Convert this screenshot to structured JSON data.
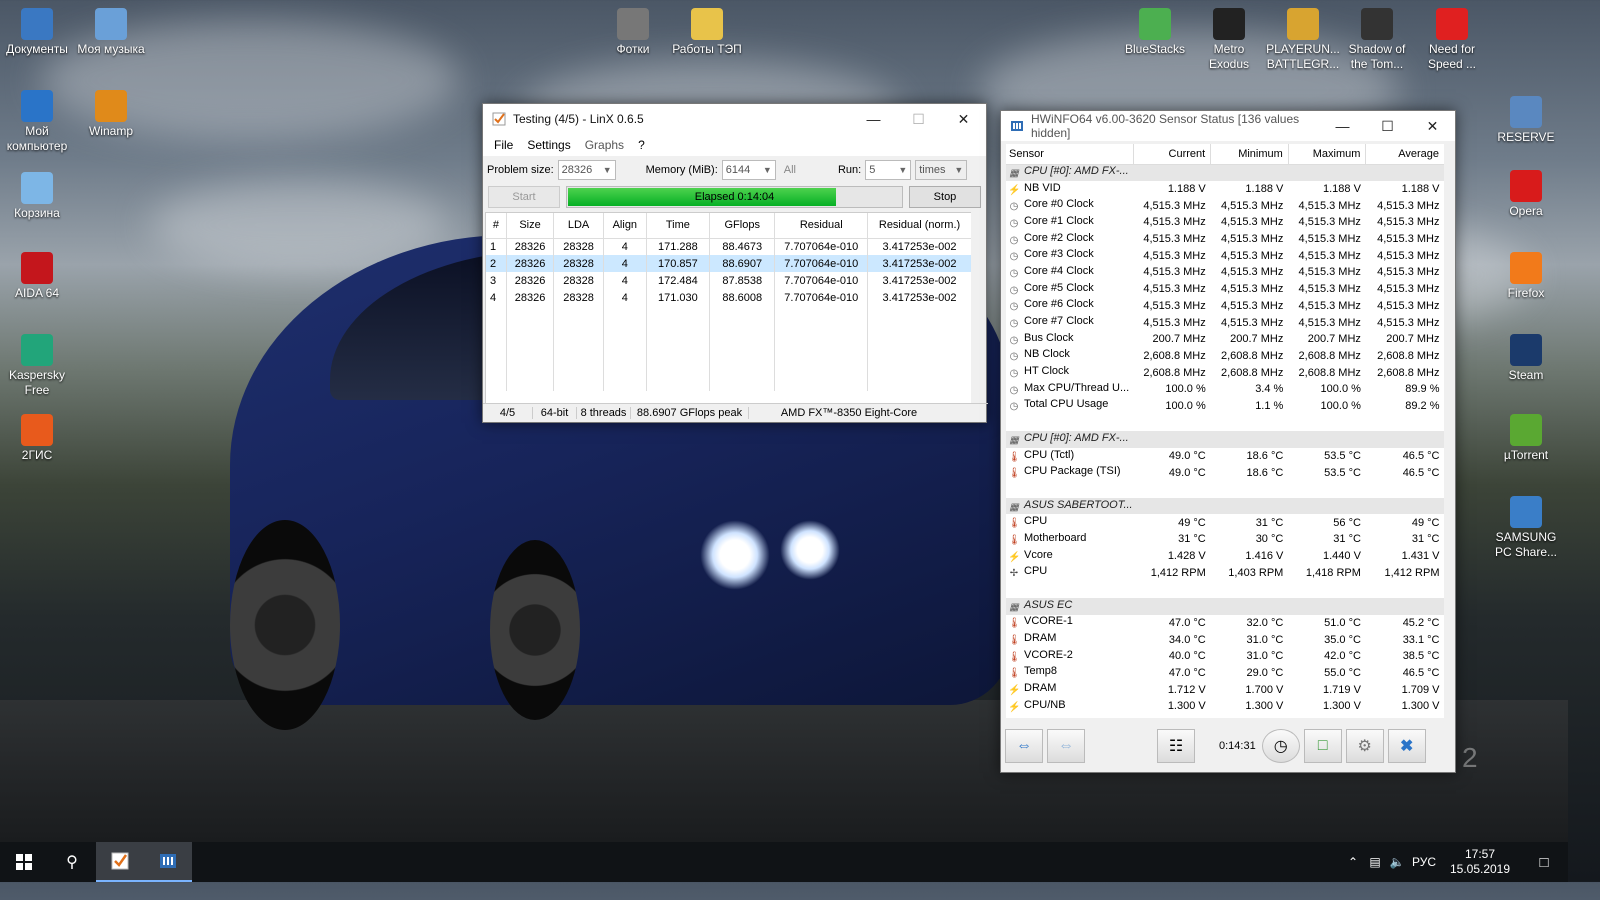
{
  "desktop": {
    "left_icons": [
      {
        "label": "Документы",
        "icon": "documents-icon",
        "color": "#3a78c2"
      },
      {
        "label": "Моя музыка",
        "icon": "music-icon",
        "color": "#6aa0d8"
      },
      {
        "label": "Мой компьютер",
        "icon": "computer-icon",
        "color": "#2a74c8"
      },
      {
        "label": "Winamp",
        "icon": "winamp-icon",
        "color": "#e08a1a"
      },
      {
        "label": "Корзина",
        "icon": "recycle-bin-icon",
        "color": "#7db6e6"
      },
      {
        "label": "AIDA 64",
        "icon": "aida64-icon",
        "color": "#c4161c"
      },
      {
        "label": "Kaspersky Free",
        "icon": "kaspersky-icon",
        "color": "#22a57a"
      },
      {
        "label": "2ГИС",
        "icon": "2gis-icon",
        "color": "#e85a1c"
      }
    ],
    "top_icons": [
      {
        "label": "Фотки",
        "icon": "camera-icon",
        "color": "#777777"
      },
      {
        "label": "Работы ТЭП",
        "icon": "folder-icon",
        "color": "#e8c34a"
      },
      {
        "label": "BlueStacks",
        "icon": "bluestacks-icon",
        "color": "#4caf50"
      },
      {
        "label": "Metro Exodus",
        "icon": "metro-exodus-icon",
        "color": "#222222"
      },
      {
        "label": "PLAYERUN... BATTLEGR...",
        "icon": "pubg-icon",
        "color": "#d8a430"
      },
      {
        "label": "Shadow of the Tom...",
        "icon": "tomb-raider-icon",
        "color": "#333333"
      },
      {
        "label": "Need for Speed ...",
        "icon": "nfs-icon",
        "color": "#e02020"
      }
    ],
    "right_icons": [
      {
        "label": "RESERVE",
        "icon": "reserve-icon",
        "color": "#5a88c0"
      },
      {
        "label": "Opera",
        "icon": "opera-icon",
        "color": "#d81b1b"
      },
      {
        "label": "Firefox",
        "icon": "firefox-icon",
        "color": "#f27a1a"
      },
      {
        "label": "Steam",
        "icon": "steam-icon",
        "color": "#1b3a6b"
      },
      {
        "label": "µTorrent",
        "icon": "utorrent-icon",
        "color": "#5aa832"
      },
      {
        "label": "SAMSUNG PC Share...",
        "icon": "samsung-icon",
        "color": "#3a7ec8"
      }
    ],
    "watermark": "2"
  },
  "linx": {
    "title": "Testing (4/5) - LinX 0.6.5",
    "menu": [
      "File",
      "Settings",
      "Graphs",
      "?"
    ],
    "problem_size_label": "Problem size:",
    "problem_size": "28326",
    "memory_label": "Memory (MiB):",
    "memory": "6144",
    "all_label": "All",
    "run_label": "Run:",
    "run": "5",
    "run_unit": "times",
    "start_label": "Start",
    "elapsed": "Elapsed 0:14:04",
    "progress": 0.8,
    "stop_label": "Stop",
    "columns": [
      "#",
      "Size",
      "LDA",
      "Align",
      "Time",
      "GFlops",
      "Residual",
      "Residual (norm.)"
    ],
    "rows": [
      [
        "1",
        "28326",
        "28328",
        "4",
        "171.288",
        "88.4673",
        "7.707064e-010",
        "3.417253e-002"
      ],
      [
        "2",
        "28326",
        "28328",
        "4",
        "170.857",
        "88.6907",
        "7.707064e-010",
        "3.417253e-002"
      ],
      [
        "3",
        "28326",
        "28328",
        "4",
        "172.484",
        "87.8538",
        "7.707064e-010",
        "3.417253e-002"
      ],
      [
        "4",
        "28326",
        "28328",
        "4",
        "171.030",
        "88.6008",
        "7.707064e-010",
        "3.417253e-002"
      ]
    ],
    "selected_row": 1,
    "status": [
      "4/5",
      "64-bit",
      "8 threads",
      "88.6907 GFlops peak",
      "AMD FX™-8350 Eight-Core"
    ]
  },
  "hwinfo": {
    "title": "HWiNFO64 v6.00-3620 Sensor Status [136 values hidden]",
    "columns": [
      "Sensor",
      "Current",
      "Minimum",
      "Maximum",
      "Average"
    ],
    "rows": [
      {
        "type": "grp",
        "name": "CPU [#0]: AMD FX-..."
      },
      {
        "type": "volt",
        "name": "NB VID",
        "v": [
          "1.188 V",
          "1.188 V",
          "1.188 V",
          "1.188 V"
        ]
      },
      {
        "type": "clock",
        "name": "Core #0 Clock",
        "v": [
          "4,515.3 MHz",
          "4,515.3 MHz",
          "4,515.3 MHz",
          "4,515.3 MHz"
        ]
      },
      {
        "type": "clock",
        "name": "Core #1 Clock",
        "v": [
          "4,515.3 MHz",
          "4,515.3 MHz",
          "4,515.3 MHz",
          "4,515.3 MHz"
        ]
      },
      {
        "type": "clock",
        "name": "Core #2 Clock",
        "v": [
          "4,515.3 MHz",
          "4,515.3 MHz",
          "4,515.3 MHz",
          "4,515.3 MHz"
        ]
      },
      {
        "type": "clock",
        "name": "Core #3 Clock",
        "v": [
          "4,515.3 MHz",
          "4,515.3 MHz",
          "4,515.3 MHz",
          "4,515.3 MHz"
        ]
      },
      {
        "type": "clock",
        "name": "Core #4 Clock",
        "v": [
          "4,515.3 MHz",
          "4,515.3 MHz",
          "4,515.3 MHz",
          "4,515.3 MHz"
        ]
      },
      {
        "type": "clock",
        "name": "Core #5 Clock",
        "v": [
          "4,515.3 MHz",
          "4,515.3 MHz",
          "4,515.3 MHz",
          "4,515.3 MHz"
        ]
      },
      {
        "type": "clock",
        "name": "Core #6 Clock",
        "v": [
          "4,515.3 MHz",
          "4,515.3 MHz",
          "4,515.3 MHz",
          "4,515.3 MHz"
        ]
      },
      {
        "type": "clock",
        "name": "Core #7 Clock",
        "v": [
          "4,515.3 MHz",
          "4,515.3 MHz",
          "4,515.3 MHz",
          "4,515.3 MHz"
        ]
      },
      {
        "type": "clock",
        "name": "Bus Clock",
        "v": [
          "200.7 MHz",
          "200.7 MHz",
          "200.7 MHz",
          "200.7 MHz"
        ]
      },
      {
        "type": "clock",
        "name": "NB Clock",
        "v": [
          "2,608.8 MHz",
          "2,608.8 MHz",
          "2,608.8 MHz",
          "2,608.8 MHz"
        ]
      },
      {
        "type": "clock",
        "name": "HT Clock",
        "v": [
          "2,608.8 MHz",
          "2,608.8 MHz",
          "2,608.8 MHz",
          "2,608.8 MHz"
        ]
      },
      {
        "type": "clock",
        "name": "Max CPU/Thread U...",
        "v": [
          "100.0 %",
          "3.4 %",
          "100.0 %",
          "89.9 %"
        ]
      },
      {
        "type": "clock",
        "name": "Total CPU Usage",
        "v": [
          "100.0 %",
          "1.1 %",
          "100.0 %",
          "89.2 %"
        ]
      },
      {
        "type": "spacer"
      },
      {
        "type": "grp",
        "name": "CPU [#0]: AMD FX-..."
      },
      {
        "type": "temp",
        "name": "CPU (Tctl)",
        "v": [
          "49.0 °C",
          "18.6 °C",
          "53.5 °C",
          "46.5 °C"
        ]
      },
      {
        "type": "temp",
        "name": "CPU Package (TSI)",
        "v": [
          "49.0 °C",
          "18.6 °C",
          "53.5 °C",
          "46.5 °C"
        ]
      },
      {
        "type": "spacer"
      },
      {
        "type": "grp",
        "name": "ASUS SABERTOOT..."
      },
      {
        "type": "temp",
        "name": "CPU",
        "v": [
          "49 °C",
          "31 °C",
          "56 °C",
          "49 °C"
        ]
      },
      {
        "type": "temp",
        "name": "Motherboard",
        "v": [
          "31 °C",
          "30 °C",
          "31 °C",
          "31 °C"
        ]
      },
      {
        "type": "volt",
        "name": "Vcore",
        "v": [
          "1.428 V",
          "1.416 V",
          "1.440 V",
          "1.431 V"
        ]
      },
      {
        "type": "fan",
        "name": "CPU",
        "v": [
          "1,412 RPM",
          "1,403 RPM",
          "1,418 RPM",
          "1,412 RPM"
        ]
      },
      {
        "type": "spacer"
      },
      {
        "type": "grp",
        "name": "ASUS EC"
      },
      {
        "type": "temp",
        "name": "VCORE-1",
        "v": [
          "47.0 °C",
          "32.0 °C",
          "51.0 °C",
          "45.2 °C"
        ]
      },
      {
        "type": "temp",
        "name": "DRAM",
        "v": [
          "34.0 °C",
          "31.0 °C",
          "35.0 °C",
          "33.1 °C"
        ]
      },
      {
        "type": "temp",
        "name": "VCORE-2",
        "v": [
          "40.0 °C",
          "31.0 °C",
          "42.0 °C",
          "38.5 °C"
        ]
      },
      {
        "type": "temp",
        "name": "Temp8",
        "v": [
          "47.0 °C",
          "29.0 °C",
          "55.0 °C",
          "46.5 °C"
        ]
      },
      {
        "type": "volt",
        "name": "DRAM",
        "v": [
          "1.712 V",
          "1.700 V",
          "1.719 V",
          "1.709 V"
        ]
      },
      {
        "type": "volt",
        "name": "CPU/NB",
        "v": [
          "1.300 V",
          "1.300 V",
          "1.300 V",
          "1.300 V"
        ]
      }
    ],
    "timer": "0:14:31"
  },
  "taskbar": {
    "lang": "РУС",
    "time": "17:57",
    "date": "15.05.2019"
  }
}
